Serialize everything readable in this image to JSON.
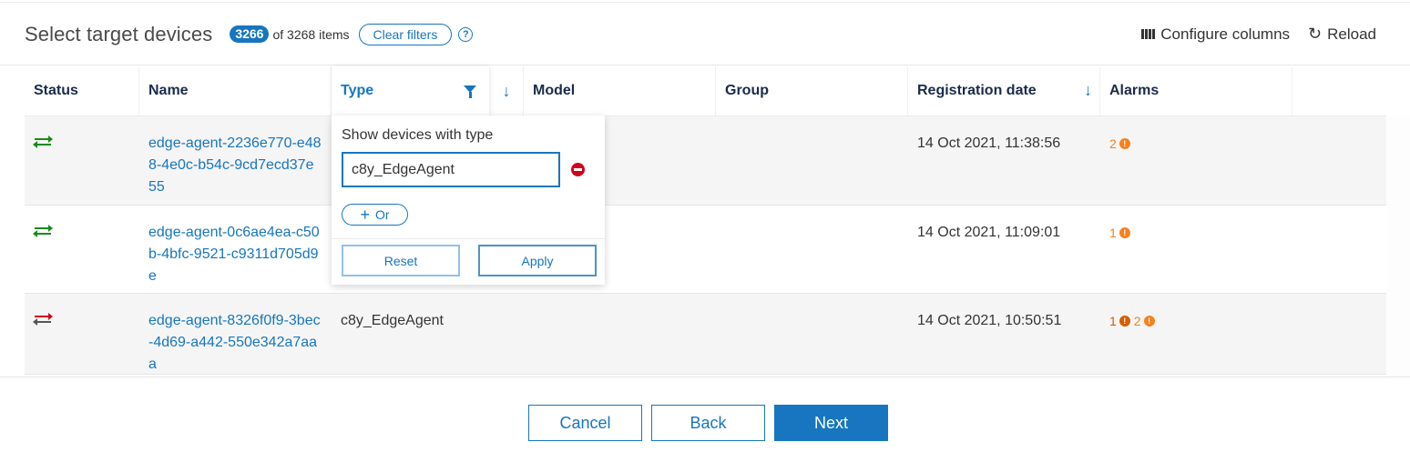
{
  "header": {
    "title": "Select target devices",
    "filtered_count": "3266",
    "total_text": "of 3268 items",
    "clear_filters_label": "Clear filters",
    "help_icon": "question-circle-icon",
    "configure_columns_label": "Configure columns",
    "reload_label": "Reload"
  },
  "table": {
    "columns": [
      {
        "label": "Status"
      },
      {
        "label": "Name"
      },
      {
        "label": "Type",
        "filtered": true
      },
      {
        "label": "Model"
      },
      {
        "label": "Group"
      },
      {
        "label": "Registration date",
        "sorted": "descending"
      },
      {
        "label": "Alarms"
      }
    ],
    "rows": [
      {
        "status": "connected",
        "status_color_top": "#1a8a1a",
        "status_color_bottom": "#1a8a1a",
        "name": "edge-agent-2236e770-e488-4e0c-b54c-9cd7ecd37e55",
        "type": "",
        "model": "",
        "group": "",
        "registration_date": "14 Oct 2021, 11:38:56",
        "alarms": [
          {
            "count": "2",
            "severity": "minor",
            "color": "#f5821f"
          }
        ]
      },
      {
        "status": "connected",
        "status_color_top": "#1a8a1a",
        "status_color_bottom": "#1a8a1a",
        "name": "edge-agent-0c6ae4ea-c50b-4bfc-9521-c9311d705d9e",
        "type": "",
        "model": "",
        "group": "",
        "registration_date": "14 Oct 2021, 11:09:01",
        "alarms": [
          {
            "count": "1",
            "severity": "minor",
            "color": "#f5821f"
          }
        ]
      },
      {
        "status": "disconnected",
        "status_color_top": "#d0021b",
        "status_color_bottom": "#555555",
        "name": "edge-agent-8326f0f9-3bec-4d69-a442-550e342a7aaa",
        "type": "c8y_EdgeAgent",
        "model": "",
        "group": "",
        "registration_date": "14 Oct 2021, 10:50:51",
        "alarms": [
          {
            "count": "1",
            "severity": "major",
            "color": "#d95b00"
          },
          {
            "count": "2",
            "severity": "minor",
            "color": "#f5821f"
          }
        ]
      }
    ]
  },
  "type_filter_popover": {
    "title": "Show devices with type",
    "value": "c8y_EdgeAgent",
    "or_label": "Or",
    "reset_label": "Reset",
    "apply_label": "Apply"
  },
  "footer": {
    "cancel_label": "Cancel",
    "back_label": "Back",
    "next_label": "Next"
  },
  "colors": {
    "accent": "#1776bf",
    "row_alt": "#f5f5f5",
    "danger": "#d0021b",
    "alarm_minor": "#f5821f",
    "alarm_major": "#d95b00"
  }
}
